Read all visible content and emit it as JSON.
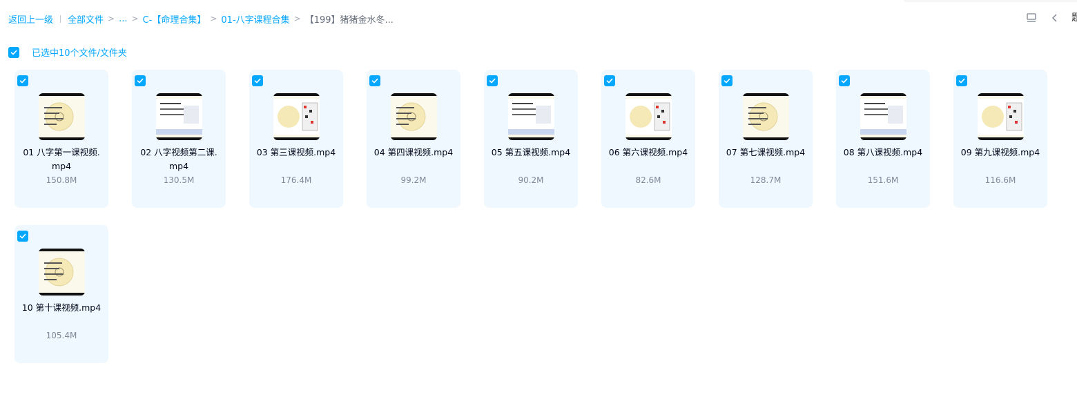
{
  "breadcrumb": {
    "back": "返回上一级",
    "all_files": "全部文件",
    "ellipsis": "...",
    "level1": "C-【命理合集】",
    "level2": "01-八字课程合集",
    "current": "【199】猪猪金水冬..."
  },
  "toolbar": {
    "clipped_text": "题"
  },
  "selection": {
    "label": "已选中10个文件/文件夹"
  },
  "colors": {
    "accent": "#06a7ff",
    "card_bg": "#eef8fe",
    "size_text": "#818999"
  },
  "files": [
    {
      "name": "01 八字第一课视频.mp4",
      "size": "150.8M",
      "checked": true,
      "thumb_icon": "video-thumbnail"
    },
    {
      "name": "02 八字视频第二课.mp4",
      "size": "130.5M",
      "checked": true,
      "thumb_icon": "video-thumbnail"
    },
    {
      "name": "03 第三课视频.mp4",
      "size": "176.4M",
      "checked": true,
      "thumb_icon": "video-thumbnail"
    },
    {
      "name": "04 第四课视频.mp4",
      "size": "99.2M",
      "checked": true,
      "thumb_icon": "video-thumbnail"
    },
    {
      "name": "05 第五课视频.mp4",
      "size": "90.2M",
      "checked": true,
      "thumb_icon": "video-thumbnail"
    },
    {
      "name": "06 第六课视频.mp4",
      "size": "82.6M",
      "checked": true,
      "thumb_icon": "video-thumbnail"
    },
    {
      "name": "07 第七课视频.mp4",
      "size": "128.7M",
      "checked": true,
      "thumb_icon": "video-thumbnail"
    },
    {
      "name": "08 第八课视频.mp4",
      "size": "151.6M",
      "checked": true,
      "thumb_icon": "video-thumbnail"
    },
    {
      "name": "09 第九课视频.mp4",
      "size": "116.6M",
      "checked": true,
      "thumb_icon": "video-thumbnail"
    },
    {
      "name": "10 第十课视频.mp4",
      "size": "105.4M",
      "checked": true,
      "thumb_icon": "video-thumbnail"
    }
  ]
}
